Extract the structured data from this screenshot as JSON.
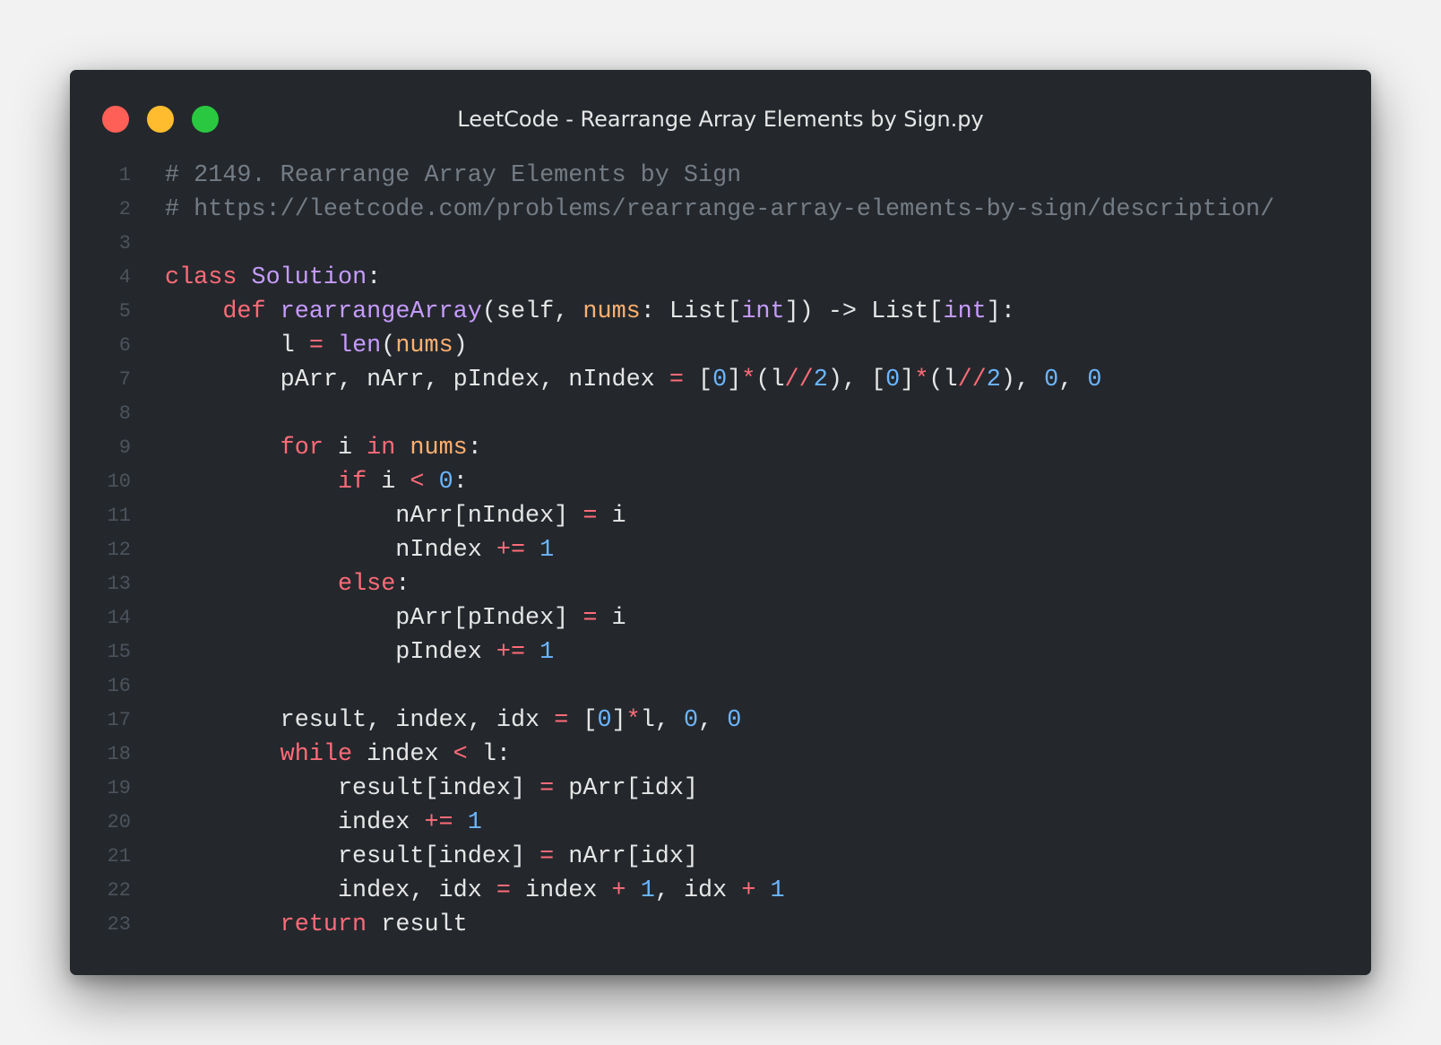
{
  "window": {
    "title": "LeetCode - Rearrange Array Elements by Sign.py"
  },
  "code_lines": [
    {
      "number": "1",
      "tokens": [
        {
          "t": "comment",
          "v": "# 2149. Rearrange Array Elements by Sign"
        }
      ]
    },
    {
      "number": "2",
      "tokens": [
        {
          "t": "comment",
          "v": "# https://leetcode.com/problems/rearrange-array-elements-by-sign/description/"
        }
      ]
    },
    {
      "number": "3",
      "tokens": []
    },
    {
      "number": "4",
      "tokens": [
        {
          "t": "keyword",
          "v": "class"
        },
        {
          "t": "plain",
          "v": " "
        },
        {
          "t": "class",
          "v": "Solution"
        },
        {
          "t": "punct",
          "v": ":"
        }
      ]
    },
    {
      "number": "5",
      "tokens": [
        {
          "t": "plain",
          "v": "    "
        },
        {
          "t": "keyword",
          "v": "def"
        },
        {
          "t": "plain",
          "v": " "
        },
        {
          "t": "function",
          "v": "rearrangeArray"
        },
        {
          "t": "punct",
          "v": "("
        },
        {
          "t": "plain",
          "v": "self"
        },
        {
          "t": "punct",
          "v": ", "
        },
        {
          "t": "param",
          "v": "nums"
        },
        {
          "t": "punct",
          "v": ": "
        },
        {
          "t": "type",
          "v": "List"
        },
        {
          "t": "punct",
          "v": "["
        },
        {
          "t": "typeparam",
          "v": "int"
        },
        {
          "t": "punct",
          "v": "]) -> "
        },
        {
          "t": "type",
          "v": "List"
        },
        {
          "t": "punct",
          "v": "["
        },
        {
          "t": "typeparam",
          "v": "int"
        },
        {
          "t": "punct",
          "v": "]:"
        }
      ]
    },
    {
      "number": "6",
      "tokens": [
        {
          "t": "plain",
          "v": "        l "
        },
        {
          "t": "operator",
          "v": "="
        },
        {
          "t": "plain",
          "v": " "
        },
        {
          "t": "builtin",
          "v": "len"
        },
        {
          "t": "punct",
          "v": "("
        },
        {
          "t": "param",
          "v": "nums"
        },
        {
          "t": "punct",
          "v": ")"
        }
      ]
    },
    {
      "number": "7",
      "tokens": [
        {
          "t": "plain",
          "v": "        pArr, nArr, pIndex, nIndex "
        },
        {
          "t": "operator",
          "v": "="
        },
        {
          "t": "plain",
          "v": " ["
        },
        {
          "t": "number",
          "v": "0"
        },
        {
          "t": "plain",
          "v": "]"
        },
        {
          "t": "operator",
          "v": "*"
        },
        {
          "t": "plain",
          "v": "(l"
        },
        {
          "t": "operator",
          "v": "//"
        },
        {
          "t": "number",
          "v": "2"
        },
        {
          "t": "plain",
          "v": "), ["
        },
        {
          "t": "number",
          "v": "0"
        },
        {
          "t": "plain",
          "v": "]"
        },
        {
          "t": "operator",
          "v": "*"
        },
        {
          "t": "plain",
          "v": "(l"
        },
        {
          "t": "operator",
          "v": "//"
        },
        {
          "t": "number",
          "v": "2"
        },
        {
          "t": "plain",
          "v": "), "
        },
        {
          "t": "number",
          "v": "0"
        },
        {
          "t": "plain",
          "v": ", "
        },
        {
          "t": "number",
          "v": "0"
        }
      ]
    },
    {
      "number": "8",
      "tokens": []
    },
    {
      "number": "9",
      "tokens": [
        {
          "t": "plain",
          "v": "        "
        },
        {
          "t": "keyword",
          "v": "for"
        },
        {
          "t": "plain",
          "v": " i "
        },
        {
          "t": "keyword",
          "v": "in"
        },
        {
          "t": "plain",
          "v": " "
        },
        {
          "t": "param",
          "v": "nums"
        },
        {
          "t": "punct",
          "v": ":"
        }
      ]
    },
    {
      "number": "10",
      "tokens": [
        {
          "t": "plain",
          "v": "            "
        },
        {
          "t": "keyword",
          "v": "if"
        },
        {
          "t": "plain",
          "v": " i "
        },
        {
          "t": "operator",
          "v": "<"
        },
        {
          "t": "plain",
          "v": " "
        },
        {
          "t": "number",
          "v": "0"
        },
        {
          "t": "punct",
          "v": ":"
        }
      ]
    },
    {
      "number": "11",
      "tokens": [
        {
          "t": "plain",
          "v": "                nArr[nIndex] "
        },
        {
          "t": "operator",
          "v": "="
        },
        {
          "t": "plain",
          "v": " i"
        }
      ]
    },
    {
      "number": "12",
      "tokens": [
        {
          "t": "plain",
          "v": "                nIndex "
        },
        {
          "t": "operator",
          "v": "+="
        },
        {
          "t": "plain",
          "v": " "
        },
        {
          "t": "number",
          "v": "1"
        }
      ]
    },
    {
      "number": "13",
      "tokens": [
        {
          "t": "plain",
          "v": "            "
        },
        {
          "t": "keyword",
          "v": "else"
        },
        {
          "t": "punct",
          "v": ":"
        }
      ]
    },
    {
      "number": "14",
      "tokens": [
        {
          "t": "plain",
          "v": "                pArr[pIndex] "
        },
        {
          "t": "operator",
          "v": "="
        },
        {
          "t": "plain",
          "v": " i"
        }
      ]
    },
    {
      "number": "15",
      "tokens": [
        {
          "t": "plain",
          "v": "                pIndex "
        },
        {
          "t": "operator",
          "v": "+="
        },
        {
          "t": "plain",
          "v": " "
        },
        {
          "t": "number",
          "v": "1"
        }
      ]
    },
    {
      "number": "16",
      "tokens": []
    },
    {
      "number": "17",
      "tokens": [
        {
          "t": "plain",
          "v": "        result, index, idx "
        },
        {
          "t": "operator",
          "v": "="
        },
        {
          "t": "plain",
          "v": " ["
        },
        {
          "t": "number",
          "v": "0"
        },
        {
          "t": "plain",
          "v": "]"
        },
        {
          "t": "operator",
          "v": "*"
        },
        {
          "t": "plain",
          "v": "l, "
        },
        {
          "t": "number",
          "v": "0"
        },
        {
          "t": "plain",
          "v": ", "
        },
        {
          "t": "number",
          "v": "0"
        }
      ]
    },
    {
      "number": "18",
      "tokens": [
        {
          "t": "plain",
          "v": "        "
        },
        {
          "t": "keyword",
          "v": "while"
        },
        {
          "t": "plain",
          "v": " index "
        },
        {
          "t": "operator",
          "v": "<"
        },
        {
          "t": "plain",
          "v": " l:"
        }
      ]
    },
    {
      "number": "19",
      "tokens": [
        {
          "t": "plain",
          "v": "            result[index] "
        },
        {
          "t": "operator",
          "v": "="
        },
        {
          "t": "plain",
          "v": " pArr[idx]"
        }
      ]
    },
    {
      "number": "20",
      "tokens": [
        {
          "t": "plain",
          "v": "            index "
        },
        {
          "t": "operator",
          "v": "+="
        },
        {
          "t": "plain",
          "v": " "
        },
        {
          "t": "number",
          "v": "1"
        }
      ]
    },
    {
      "number": "21",
      "tokens": [
        {
          "t": "plain",
          "v": "            result[index] "
        },
        {
          "t": "operator",
          "v": "="
        },
        {
          "t": "plain",
          "v": " nArr[idx]"
        }
      ]
    },
    {
      "number": "22",
      "tokens": [
        {
          "t": "plain",
          "v": "            index, idx "
        },
        {
          "t": "operator",
          "v": "="
        },
        {
          "t": "plain",
          "v": " index "
        },
        {
          "t": "operator",
          "v": "+"
        },
        {
          "t": "plain",
          "v": " "
        },
        {
          "t": "number",
          "v": "1"
        },
        {
          "t": "plain",
          "v": ", idx "
        },
        {
          "t": "operator",
          "v": "+"
        },
        {
          "t": "plain",
          "v": " "
        },
        {
          "t": "number",
          "v": "1"
        }
      ]
    },
    {
      "number": "23",
      "tokens": [
        {
          "t": "plain",
          "v": "        "
        },
        {
          "t": "keyword",
          "v": "return"
        },
        {
          "t": "plain",
          "v": " result"
        }
      ]
    }
  ],
  "colors": {
    "window_background": "#24282d",
    "comment": "#747c85",
    "keyword": "#ff6b78",
    "class_function": "#c79bff",
    "param": "#ffb070",
    "number": "#6cb6ff",
    "text": "#e6e6e6",
    "line_number": "#4c535c",
    "close_dot": "#fe5f57",
    "minimize_dot": "#febc2e",
    "zoom_dot": "#29c840"
  },
  "icons": {
    "close": "close-dot-icon",
    "minimize": "minimize-dot-icon",
    "zoom": "zoom-dot-icon"
  }
}
